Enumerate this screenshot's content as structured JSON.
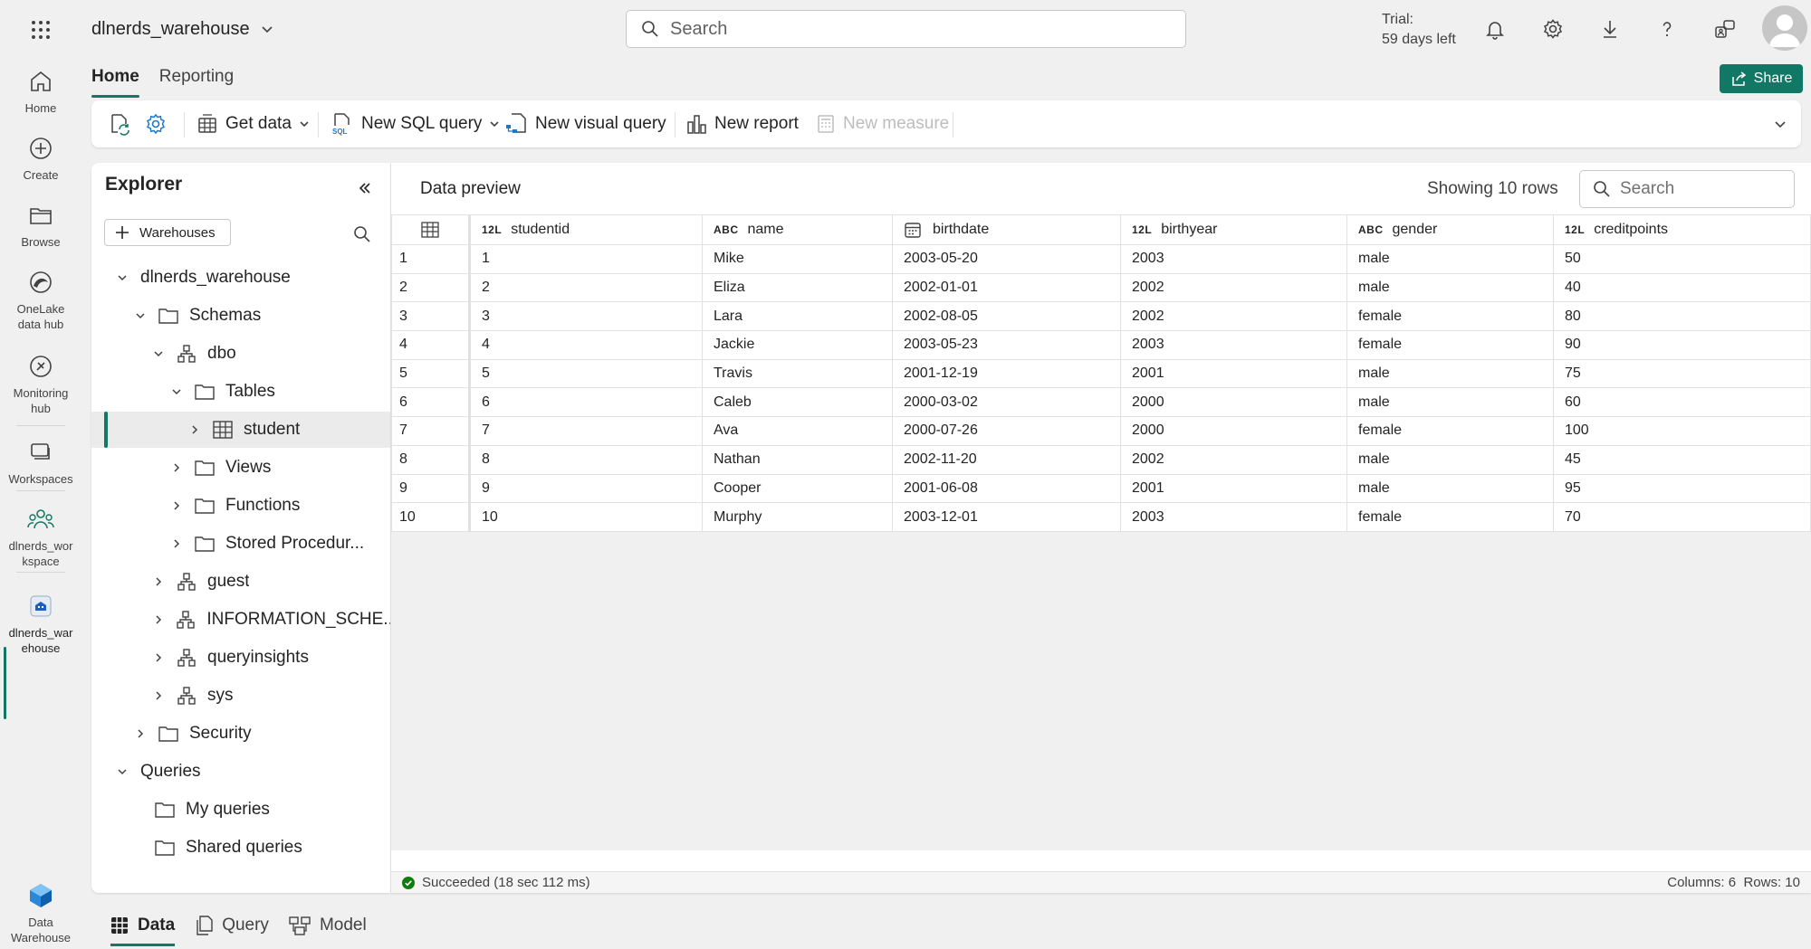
{
  "app": {
    "workspace_name": "dlnerds_warehouse",
    "search_placeholder": "Search",
    "trial_line1": "Trial:",
    "trial_line2": "59 days left"
  },
  "rail": {
    "items": [
      {
        "label": "Home",
        "icon": "home-icon"
      },
      {
        "label": "Create",
        "icon": "create-icon"
      },
      {
        "label": "Browse",
        "icon": "browse-icon"
      },
      {
        "label": "OneLake data hub",
        "icon": "onelake-icon"
      },
      {
        "label": "Monitoring hub",
        "icon": "monitoring-icon"
      },
      {
        "label": "Workspaces",
        "icon": "workspaces-icon"
      },
      {
        "label": "dlnerds_workspace",
        "icon": "workspace-icon"
      },
      {
        "label": "dlnerds_warehouse",
        "icon": "warehouse-icon"
      }
    ],
    "footer_label": "Data Warehouse"
  },
  "ribbon": {
    "tabs": [
      {
        "label": "Home",
        "active": true
      },
      {
        "label": "Reporting",
        "active": false
      }
    ],
    "share_label": "Share",
    "get_data": "Get data",
    "new_sql_query": "New SQL query",
    "new_visual_query": "New visual query",
    "new_report": "New report",
    "new_measure": "New measure"
  },
  "explorer": {
    "title": "Explorer",
    "warehouses_button": "Warehouses",
    "tree": [
      {
        "label": "dlnerds_warehouse",
        "expanded": true
      },
      {
        "label": "Schemas",
        "expanded": true
      },
      {
        "label": "dbo",
        "expanded": true
      },
      {
        "label": "Tables",
        "expanded": true
      },
      {
        "label": "student",
        "expanded": false,
        "selected": true
      },
      {
        "label": "Views",
        "expanded": false
      },
      {
        "label": "Functions",
        "expanded": false
      },
      {
        "label": "Stored Procedur...",
        "expanded": false
      },
      {
        "label": "guest",
        "expanded": false
      },
      {
        "label": "INFORMATION_SCHE...",
        "expanded": false
      },
      {
        "label": "queryinsights",
        "expanded": false
      },
      {
        "label": "sys",
        "expanded": false
      },
      {
        "label": "Security",
        "expanded": false
      },
      {
        "label": "Queries",
        "expanded": true
      },
      {
        "label": "My queries"
      },
      {
        "label": "Shared queries"
      }
    ]
  },
  "preview": {
    "title": "Data preview",
    "rows_label": "Showing 10 rows",
    "search_placeholder": "Search",
    "columns": [
      {
        "name": "studentid",
        "type": "12L"
      },
      {
        "name": "name",
        "type": "ABC"
      },
      {
        "name": "birthdate",
        "type": "calendar"
      },
      {
        "name": "birthyear",
        "type": "12L"
      },
      {
        "name": "gender",
        "type": "ABC"
      },
      {
        "name": "creditpoints",
        "type": "12L"
      }
    ],
    "rows": [
      [
        "1",
        "1",
        "Mike",
        "2003-05-20",
        "2003",
        "male",
        "50"
      ],
      [
        "2",
        "2",
        "Eliza",
        "2002-01-01",
        "2002",
        "male",
        "40"
      ],
      [
        "3",
        "3",
        "Lara",
        "2002-08-05",
        "2002",
        "female",
        "80"
      ],
      [
        "4",
        "4",
        "Jackie",
        "2003-05-23",
        "2003",
        "female",
        "90"
      ],
      [
        "5",
        "5",
        "Travis",
        "2001-12-19",
        "2001",
        "male",
        "75"
      ],
      [
        "6",
        "6",
        "Caleb",
        "2000-03-02",
        "2000",
        "male",
        "60"
      ],
      [
        "7",
        "7",
        "Ava",
        "2000-07-26",
        "2000",
        "female",
        "100"
      ],
      [
        "8",
        "8",
        "Nathan",
        "2002-11-20",
        "2002",
        "male",
        "45"
      ],
      [
        "9",
        "9",
        "Cooper",
        "2001-06-08",
        "2001",
        "male",
        "95"
      ],
      [
        "10",
        "10",
        "Murphy",
        "2003-12-01",
        "2003",
        "female",
        "70"
      ]
    ],
    "status": "Succeeded (18 sec 112 ms)",
    "columns_count": "Columns: 6",
    "rows_count": "Rows: 10"
  },
  "bottom_tabs": [
    {
      "label": "Data",
      "active": true
    },
    {
      "label": "Query",
      "active": false
    },
    {
      "label": "Model",
      "active": false
    }
  ],
  "colors": {
    "accent": "#117865",
    "background": "#f0f0f0",
    "panel": "#ffffff"
  }
}
